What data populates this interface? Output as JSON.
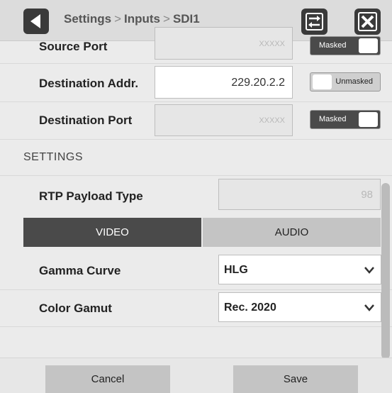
{
  "header": {
    "crumbs": [
      "Settings",
      "Inputs",
      "SDI1"
    ],
    "separator": ">"
  },
  "source_port": {
    "label": "Source Port",
    "value": "XXXXX",
    "toggle_label": "Masked",
    "toggle_state": "masked"
  },
  "dest_addr": {
    "label": "Destination Addr.",
    "value": "229.20.2.2",
    "toggle_label": "Unmasked",
    "toggle_state": "unmasked"
  },
  "dest_port": {
    "label": "Destination Port",
    "value": "XXXXX",
    "toggle_label": "Masked",
    "toggle_state": "masked"
  },
  "settings": {
    "section_title": "SETTINGS",
    "rtp": {
      "label": "RTP Payload Type",
      "value": "98"
    },
    "tabs": [
      {
        "label": "VIDEO",
        "active": true
      },
      {
        "label": "AUDIO",
        "active": false
      }
    ],
    "gamma": {
      "label": "Gamma Curve",
      "value": "HLG"
    },
    "gamut": {
      "label": "Color Gamut",
      "value": "Rec. 2020"
    }
  },
  "footer": {
    "cancel_label": "Cancel",
    "save_label": "Save"
  },
  "icons": {
    "back": "back-arrow-icon",
    "swap": "swap-arrows-icon",
    "close": "close-x-icon",
    "dropdown": "chevron-down-icon"
  },
  "colors": {
    "dark_button": "#3a3a3a",
    "masked_toggle": "#4a4a4a",
    "unmasked_toggle": "#cfcfcf"
  }
}
